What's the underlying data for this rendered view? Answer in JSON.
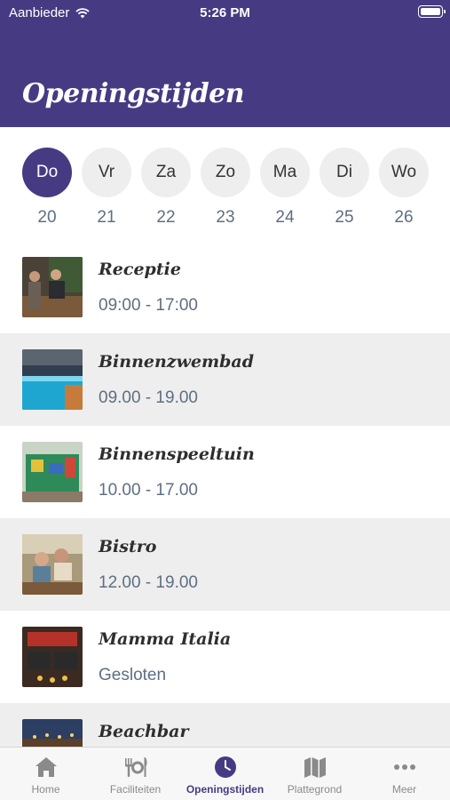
{
  "status_bar": {
    "carrier": "Aanbieder",
    "time": "5:26 PM"
  },
  "header": {
    "title": "Openingstijden"
  },
  "days": [
    {
      "label": "Do",
      "date": "20",
      "active": true
    },
    {
      "label": "Vr",
      "date": "21",
      "active": false
    },
    {
      "label": "Za",
      "date": "22",
      "active": false
    },
    {
      "label": "Zo",
      "date": "23",
      "active": false
    },
    {
      "label": "Ma",
      "date": "24",
      "active": false
    },
    {
      "label": "Di",
      "date": "25",
      "active": false
    },
    {
      "label": "Wo",
      "date": "26",
      "active": false
    }
  ],
  "facilities": [
    {
      "name": "Receptie",
      "hours": "09:00 - 17:00"
    },
    {
      "name": "Binnenzwembad",
      "hours": " 09.00 - 19.00"
    },
    {
      "name": "Binnenspeeltuin",
      "hours": "10.00 - 17.00"
    },
    {
      "name": "Bistro",
      "hours": "12.00 - 19.00"
    },
    {
      "name": "Mamma Italia",
      "hours": "Gesloten"
    },
    {
      "name": "Beachbar",
      "hours": ""
    }
  ],
  "tabs": [
    {
      "label": "Home",
      "icon": "house-icon",
      "active": false
    },
    {
      "label": "Faciliteiten",
      "icon": "cutlery-icon",
      "active": false
    },
    {
      "label": "Openingstijden",
      "icon": "clock-icon",
      "active": true
    },
    {
      "label": "Plattegrond",
      "icon": "map-icon",
      "active": false
    },
    {
      "label": "Meer",
      "icon": "more-icon",
      "active": false
    }
  ],
  "colors": {
    "brand": "#463b82",
    "alt_row": "#eeeeee",
    "hours_text": "#5e6f82",
    "tab_inactive": "#8a8a8a"
  }
}
